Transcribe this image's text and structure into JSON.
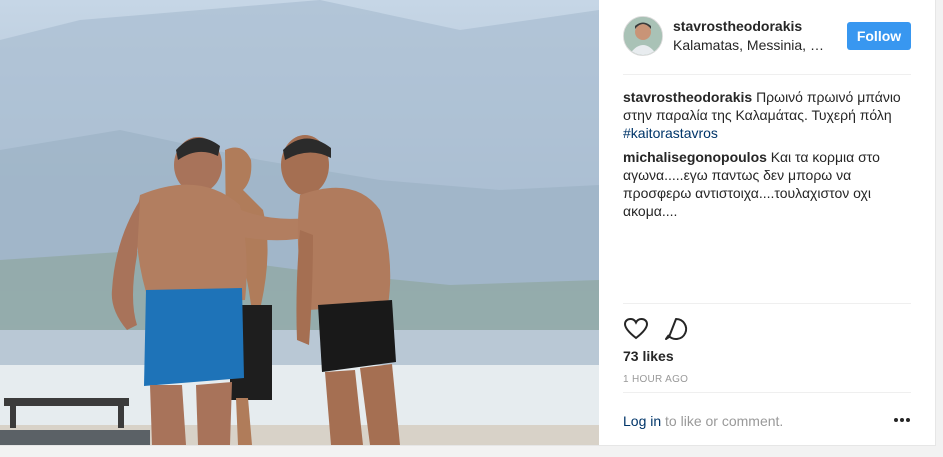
{
  "post": {
    "username": "stavrostheodorakis",
    "location": "Kalamatas, Messinia, Greece",
    "follow_label": "Follow",
    "avatar_icon": "profile-photo"
  },
  "caption": {
    "username": "stavrostheodorakis",
    "text": "Πρωινό πρωινό μπάνιο στην παραλία της Καλαμάτας. Τυχερή πόλη",
    "hashtag": "#kaitorastavros"
  },
  "comments": [
    {
      "username": "michalisegonopoulos",
      "text": "Και τα κορμια στο αγωνα.....εγω παντως δεν μπορω να προσφερω αντιστοιχα....τουλαχιστον οχι ακομα...."
    }
  ],
  "actions": {
    "like_icon": "heart-icon",
    "comment_icon": "comment-icon",
    "likes": "73 likes",
    "timestamp": "1 hour ago",
    "login_link": "Log in",
    "login_suffix": " to like or comment.",
    "more_icon": "ellipsis-icon"
  },
  "colors": {
    "follow_button": "#3897f0",
    "link": "#003569",
    "muted": "#999999"
  }
}
